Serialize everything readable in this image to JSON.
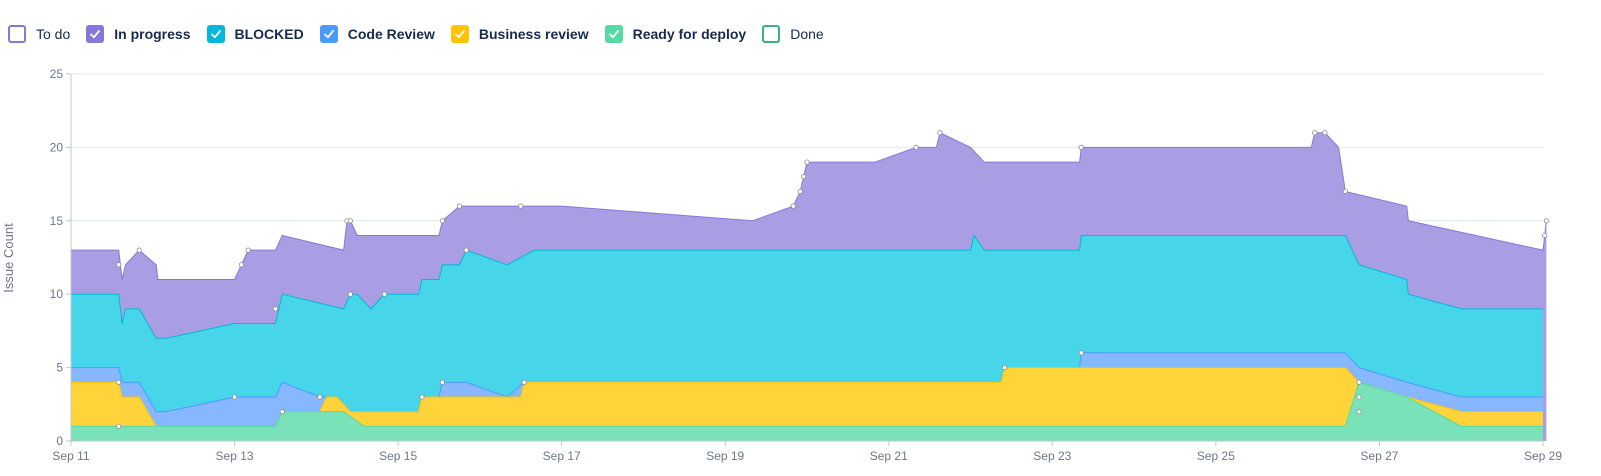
{
  "legend": [
    {
      "label": "To do",
      "color": "#8777d9",
      "checked": false,
      "bold": false
    },
    {
      "label": "In progress",
      "color": "#8777d9",
      "checked": true,
      "bold": true
    },
    {
      "label": "BLOCKED",
      "color": "#00b8d9",
      "checked": true,
      "bold": true
    },
    {
      "label": "Code Review",
      "color": "#4c9aff",
      "checked": true,
      "bold": true
    },
    {
      "label": "Business review",
      "color": "#ffc400",
      "checked": true,
      "bold": true
    },
    {
      "label": "Ready for deploy",
      "color": "#57d9a3",
      "checked": true,
      "bold": true
    },
    {
      "label": "Done",
      "color": "#36b37e",
      "checked": false,
      "bold": false
    }
  ],
  "chart_data": {
    "type": "area",
    "stacked": true,
    "ylabel": "Issue Count",
    "xlabel": "",
    "ylim": [
      0,
      25
    ],
    "xlim": [
      "2024-09-11",
      "2024-09-29"
    ],
    "yticks": [
      0,
      5,
      10,
      15,
      20,
      25
    ],
    "xticks": [
      {
        "label": "Sep 11",
        "value": "2024-09-11"
      },
      {
        "label": "Sep 13",
        "value": "2024-09-13"
      },
      {
        "label": "Sep 15",
        "value": "2024-09-15"
      },
      {
        "label": "Sep 17",
        "value": "2024-09-17"
      },
      {
        "label": "Sep 19",
        "value": "2024-09-19"
      },
      {
        "label": "Sep 21",
        "value": "2024-09-21"
      },
      {
        "label": "Sep 23",
        "value": "2024-09-23"
      },
      {
        "label": "Sep 25",
        "value": "2024-09-25"
      },
      {
        "label": "Sep 27",
        "value": "2024-09-27"
      },
      {
        "label": "Sep 29",
        "value": "2024-09-29"
      }
    ],
    "grid": true,
    "series": [
      {
        "name": "Ready for deploy",
        "fill": "#79e2b8",
        "stroke": "#57d9a3",
        "points": [
          [
            "2024-09-11T00:00",
            1
          ],
          [
            "2024-09-11T14:00",
            1
          ],
          [
            "2024-09-13T12:00",
            1
          ],
          [
            "2024-09-13T14:00",
            2
          ],
          [
            "2024-09-14T08:00",
            2
          ],
          [
            "2024-09-14T14:00",
            1
          ],
          [
            "2024-09-26T14:00",
            1
          ],
          [
            "2024-09-26T18:00",
            4
          ],
          [
            "2024-09-27T08:00",
            3
          ],
          [
            "2024-09-28T00:00",
            1
          ],
          [
            "2024-09-29T00:00",
            1
          ]
        ]
      },
      {
        "name": "Business review",
        "fill": "#ffd43b",
        "stroke": "#ffc400",
        "points": [
          [
            "2024-09-11T00:00",
            4
          ],
          [
            "2024-09-11T14:00",
            4
          ],
          [
            "2024-09-11T15:00",
            3
          ],
          [
            "2024-09-11T20:00",
            3
          ],
          [
            "2024-09-12T01:00",
            1
          ],
          [
            "2024-09-13T12:00",
            1
          ],
          [
            "2024-09-13T14:00",
            2
          ],
          [
            "2024-09-14T01:00",
            2
          ],
          [
            "2024-09-14T03:00",
            3
          ],
          [
            "2024-09-14T06:00",
            3
          ],
          [
            "2024-09-14T10:00",
            2
          ],
          [
            "2024-09-15T06:00",
            2
          ],
          [
            "2024-09-15T07:00",
            3
          ],
          [
            "2024-09-16T12:00",
            3
          ],
          [
            "2024-09-16T13:00",
            4
          ],
          [
            "2024-09-22T09:00",
            4
          ],
          [
            "2024-09-22T10:00",
            5
          ],
          [
            "2024-09-26T14:00",
            5
          ],
          [
            "2024-09-26T18:00",
            4
          ],
          [
            "2024-09-27T08:00",
            3
          ],
          [
            "2024-09-28T00:00",
            2
          ],
          [
            "2024-09-29T00:00",
            2
          ]
        ]
      },
      {
        "name": "Code Review",
        "fill": "#87b8ff",
        "stroke": "#4c9aff",
        "points": [
          [
            "2024-09-11T00:00",
            5
          ],
          [
            "2024-09-11T14:00",
            5
          ],
          [
            "2024-09-11T15:00",
            4
          ],
          [
            "2024-09-11T20:00",
            4
          ],
          [
            "2024-09-12T01:00",
            2
          ],
          [
            "2024-09-12T04:00",
            2
          ],
          [
            "2024-09-13T00:00",
            3
          ],
          [
            "2024-09-13T12:00",
            3
          ],
          [
            "2024-09-13T14:00",
            4
          ],
          [
            "2024-09-14T01:00",
            3
          ],
          [
            "2024-09-14T06:00",
            3
          ],
          [
            "2024-09-14T10:00",
            2
          ],
          [
            "2024-09-15T06:00",
            2
          ],
          [
            "2024-09-15T07:00",
            3
          ],
          [
            "2024-09-15T12:00",
            3
          ],
          [
            "2024-09-15T13:00",
            4
          ],
          [
            "2024-09-15T20:00",
            4
          ],
          [
            "2024-09-16T08:00",
            3
          ],
          [
            "2024-09-16T13:00",
            4
          ],
          [
            "2024-09-22T09:00",
            4
          ],
          [
            "2024-09-22T10:00",
            5
          ],
          [
            "2024-09-23T08:00",
            5
          ],
          [
            "2024-09-23T08:30",
            6
          ],
          [
            "2024-09-26T14:00",
            6
          ],
          [
            "2024-09-26T18:00",
            5
          ],
          [
            "2024-09-27T08:00",
            4
          ],
          [
            "2024-09-28T00:00",
            3
          ],
          [
            "2024-09-29T00:00",
            3
          ]
        ]
      },
      {
        "name": "BLOCKED",
        "fill": "#47d5ea",
        "stroke": "#00b8d9",
        "points": [
          [
            "2024-09-11T00:00",
            10
          ],
          [
            "2024-09-11T14:00",
            10
          ],
          [
            "2024-09-11T15:00",
            8
          ],
          [
            "2024-09-11T16:00",
            9
          ],
          [
            "2024-09-11T20:00",
            9
          ],
          [
            "2024-09-12T01:00",
            7
          ],
          [
            "2024-09-12T04:00",
            7
          ],
          [
            "2024-09-13T00:00",
            8
          ],
          [
            "2024-09-13T12:00",
            8
          ],
          [
            "2024-09-13T14:00",
            10
          ],
          [
            "2024-09-14T08:00",
            9
          ],
          [
            "2024-09-14T10:00",
            10
          ],
          [
            "2024-09-14T12:00",
            10
          ],
          [
            "2024-09-14T16:00",
            9
          ],
          [
            "2024-09-14T20:00",
            10
          ],
          [
            "2024-09-15T06:00",
            10
          ],
          [
            "2024-09-15T07:00",
            11
          ],
          [
            "2024-09-15T12:00",
            11
          ],
          [
            "2024-09-15T13:00",
            12
          ],
          [
            "2024-09-15T18:00",
            12
          ],
          [
            "2024-09-15T20:00",
            13
          ],
          [
            "2024-09-16T08:00",
            12
          ],
          [
            "2024-09-16T16:00",
            13
          ],
          [
            "2024-09-22T00:00",
            13
          ],
          [
            "2024-09-22T01:00",
            14
          ],
          [
            "2024-09-22T04:00",
            13
          ],
          [
            "2024-09-23T08:00",
            13
          ],
          [
            "2024-09-23T08:30",
            14
          ],
          [
            "2024-09-26T14:00",
            14
          ],
          [
            "2024-09-26T18:00",
            12
          ],
          [
            "2024-09-27T08:00",
            11
          ],
          [
            "2024-09-27T08:30",
            10
          ],
          [
            "2024-09-28T00:00",
            9
          ],
          [
            "2024-09-29T00:00",
            9
          ]
        ]
      },
      {
        "name": "In progress",
        "fill": "#a99ee4",
        "stroke": "#8777d9",
        "points": [
          [
            "2024-09-11T00:00",
            13
          ],
          [
            "2024-09-11T14:00",
            13
          ],
          [
            "2024-09-11T15:00",
            11
          ],
          [
            "2024-09-11T16:00",
            12
          ],
          [
            "2024-09-11T20:00",
            13
          ],
          [
            "2024-09-12T01:00",
            12
          ],
          [
            "2024-09-12T01:30",
            11
          ],
          [
            "2024-09-13T00:00",
            11
          ],
          [
            "2024-09-13T02:00",
            12
          ],
          [
            "2024-09-13T04:00",
            13
          ],
          [
            "2024-09-13T12:00",
            13
          ],
          [
            "2024-09-13T14:00",
            14
          ],
          [
            "2024-09-14T08:00",
            13
          ],
          [
            "2024-09-14T09:00",
            15
          ],
          [
            "2024-09-14T10:00",
            15
          ],
          [
            "2024-09-14T12:00",
            14
          ],
          [
            "2024-09-15T12:00",
            14
          ],
          [
            "2024-09-15T13:00",
            15
          ],
          [
            "2024-09-15T18:00",
            16
          ],
          [
            "2024-09-16T12:00",
            16
          ],
          [
            "2024-09-17T00:00",
            16
          ],
          [
            "2024-09-19T08:00",
            15
          ],
          [
            "2024-09-19T20:00",
            16
          ],
          [
            "2024-09-19T22:00",
            17
          ],
          [
            "2024-09-19T23:00",
            18
          ],
          [
            "2024-09-20T00:00",
            19
          ],
          [
            "2024-09-20T20:00",
            19
          ],
          [
            "2024-09-21T08:00",
            20
          ],
          [
            "2024-09-21T14:00",
            20
          ],
          [
            "2024-09-21T15:00",
            21
          ],
          [
            "2024-09-22T00:00",
            20
          ],
          [
            "2024-09-22T04:00",
            19
          ],
          [
            "2024-09-23T08:00",
            19
          ],
          [
            "2024-09-23T08:30",
            20
          ],
          [
            "2024-09-26T04:00",
            20
          ],
          [
            "2024-09-26T05:00",
            21
          ],
          [
            "2024-09-26T08:00",
            21
          ],
          [
            "2024-09-26T12:00",
            20
          ],
          [
            "2024-09-26T14:00",
            17
          ],
          [
            "2024-09-27T08:00",
            16
          ],
          [
            "2024-09-27T08:30",
            15
          ],
          [
            "2024-09-29T00:00",
            13
          ],
          [
            "2024-09-29T00:30",
            14
          ],
          [
            "2024-09-29T01:00",
            15
          ]
        ]
      }
    ],
    "markers": [
      {
        "date": "2024-09-11T14:00",
        "value": 12
      },
      {
        "date": "2024-09-11T20:00",
        "value": 13
      },
      {
        "date": "2024-09-13T02:00",
        "value": 12
      },
      {
        "date": "2024-09-13T04:00",
        "value": 13
      },
      {
        "date": "2024-09-14T09:00",
        "value": 15
      },
      {
        "date": "2024-09-14T10:00",
        "value": 15
      },
      {
        "date": "2024-09-15T13:00",
        "value": 15
      },
      {
        "date": "2024-09-15T18:00",
        "value": 16
      },
      {
        "date": "2024-09-16T12:00",
        "value": 16
      },
      {
        "date": "2024-09-19T20:00",
        "value": 16
      },
      {
        "date": "2024-09-19T22:00",
        "value": 17
      },
      {
        "date": "2024-09-19T23:00",
        "value": 18
      },
      {
        "date": "2024-09-20T00:00",
        "value": 19
      },
      {
        "date": "2024-09-21T08:00",
        "value": 20
      },
      {
        "date": "2024-09-21T15:00",
        "value": 21
      },
      {
        "date": "2024-09-23T08:30",
        "value": 20
      },
      {
        "date": "2024-09-26T05:00",
        "value": 21
      },
      {
        "date": "2024-09-26T08:00",
        "value": 21
      },
      {
        "date": "2024-09-26T14:00",
        "value": 17
      },
      {
        "date": "2024-09-29T00:30",
        "value": 14
      },
      {
        "date": "2024-09-29T01:00",
        "value": 15
      },
      {
        "date": "2024-09-13T12:00",
        "value": 9
      },
      {
        "date": "2024-09-14T10:00",
        "value": 10
      },
      {
        "date": "2024-09-14T20:00",
        "value": 10
      },
      {
        "date": "2024-09-15T20:00",
        "value": 13
      },
      {
        "date": "2024-09-11T14:00",
        "value": 4
      },
      {
        "date": "2024-09-11T14:00",
        "value": 1
      },
      {
        "date": "2024-09-13T00:00",
        "value": 3
      },
      {
        "date": "2024-09-13T14:00",
        "value": 2
      },
      {
        "date": "2024-09-14T01:00",
        "value": 3
      },
      {
        "date": "2024-09-15T07:00",
        "value": 3
      },
      {
        "date": "2024-09-15T13:00",
        "value": 4
      },
      {
        "date": "2024-09-16T13:00",
        "value": 4
      },
      {
        "date": "2024-09-22T10:00",
        "value": 5
      },
      {
        "date": "2024-09-23T08:30",
        "value": 6
      },
      {
        "date": "2024-09-26T18:00",
        "value": 4
      },
      {
        "date": "2024-09-26T18:00",
        "value": 3
      },
      {
        "date": "2024-09-26T18:00",
        "value": 2
      }
    ]
  }
}
